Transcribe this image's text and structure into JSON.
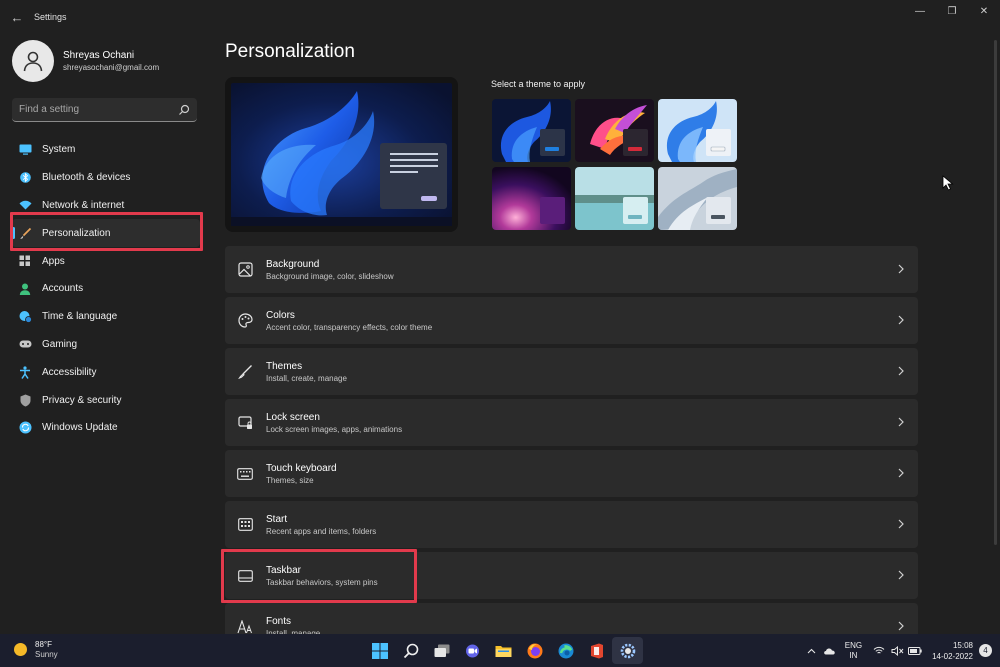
{
  "window": {
    "title": "Settings",
    "controls": [
      "minimize",
      "restore",
      "close"
    ]
  },
  "profile": {
    "name": "Shreyas Ochani",
    "email": "shreyasochani@gmail.com"
  },
  "search": {
    "placeholder": "Find a setting",
    "icon": "search-icon"
  },
  "sidebar": {
    "items": [
      {
        "label": "System",
        "icon": "monitor-icon",
        "color": "#4cc2ff"
      },
      {
        "label": "Bluetooth & devices",
        "icon": "bluetooth-icon",
        "color": "#4cc2ff"
      },
      {
        "label": "Network & internet",
        "icon": "wifi-icon",
        "color": "#4cc2ff"
      },
      {
        "label": "Personalization",
        "icon": "brush-icon",
        "color": "#e8a35c",
        "active": true
      },
      {
        "label": "Apps",
        "icon": "apps-icon",
        "color": "#c8c8c8"
      },
      {
        "label": "Accounts",
        "icon": "person-icon",
        "color": "#3fc27e"
      },
      {
        "label": "Time & language",
        "icon": "globe-clock-icon",
        "color": "#4cc2ff"
      },
      {
        "label": "Gaming",
        "icon": "gamepad-icon",
        "color": "#c8c8c8"
      },
      {
        "label": "Accessibility",
        "icon": "accessibility-icon",
        "color": "#4cc2ff"
      },
      {
        "label": "Privacy & security",
        "icon": "shield-icon",
        "color": "#a0a0a0"
      },
      {
        "label": "Windows Update",
        "icon": "update-icon",
        "color": "#4cc2ff"
      }
    ]
  },
  "main": {
    "title": "Personalization",
    "theme_label": "Select a theme to apply",
    "themes": [
      {
        "name": "windows-dark",
        "accent": "#1f7fe0"
      },
      {
        "name": "glow",
        "accent": "#d42a3a"
      },
      {
        "name": "windows-light",
        "accent": "#f5f5f5"
      },
      {
        "name": "captured-motion",
        "accent": "#5a1e7a"
      },
      {
        "name": "sunrise",
        "accent": "#8fd1d8"
      },
      {
        "name": "flow",
        "accent": "#4a5560"
      }
    ],
    "cards": [
      {
        "title": "Background",
        "subtitle": "Background image, color, slideshow",
        "icon": "image-icon"
      },
      {
        "title": "Colors",
        "subtitle": "Accent color, transparency effects, color theme",
        "icon": "palette-icon"
      },
      {
        "title": "Themes",
        "subtitle": "Install, create, manage",
        "icon": "brush-icon"
      },
      {
        "title": "Lock screen",
        "subtitle": "Lock screen images, apps, animations",
        "icon": "lock-screen-icon"
      },
      {
        "title": "Touch keyboard",
        "subtitle": "Themes, size",
        "icon": "keyboard-icon"
      },
      {
        "title": "Start",
        "subtitle": "Recent apps and items, folders",
        "icon": "start-icon"
      },
      {
        "title": "Taskbar",
        "subtitle": "Taskbar behaviors, system pins",
        "icon": "taskbar-icon"
      },
      {
        "title": "Fonts",
        "subtitle": "Install, manage",
        "icon": "fonts-icon"
      }
    ]
  },
  "taskbar": {
    "weather": {
      "temp": "88°F",
      "condition": "Sunny"
    },
    "apps": [
      "windows-start-icon",
      "search-icon",
      "task-view-icon",
      "chat-icon",
      "file-explorer-icon",
      "firefox-icon",
      "edge-icon",
      "office-icon",
      "settings-icon"
    ],
    "lang": {
      "line1": "ENG",
      "line2": "IN"
    },
    "clock": {
      "time": "15:08",
      "date": "14-02-2022"
    },
    "notifications": "4"
  }
}
